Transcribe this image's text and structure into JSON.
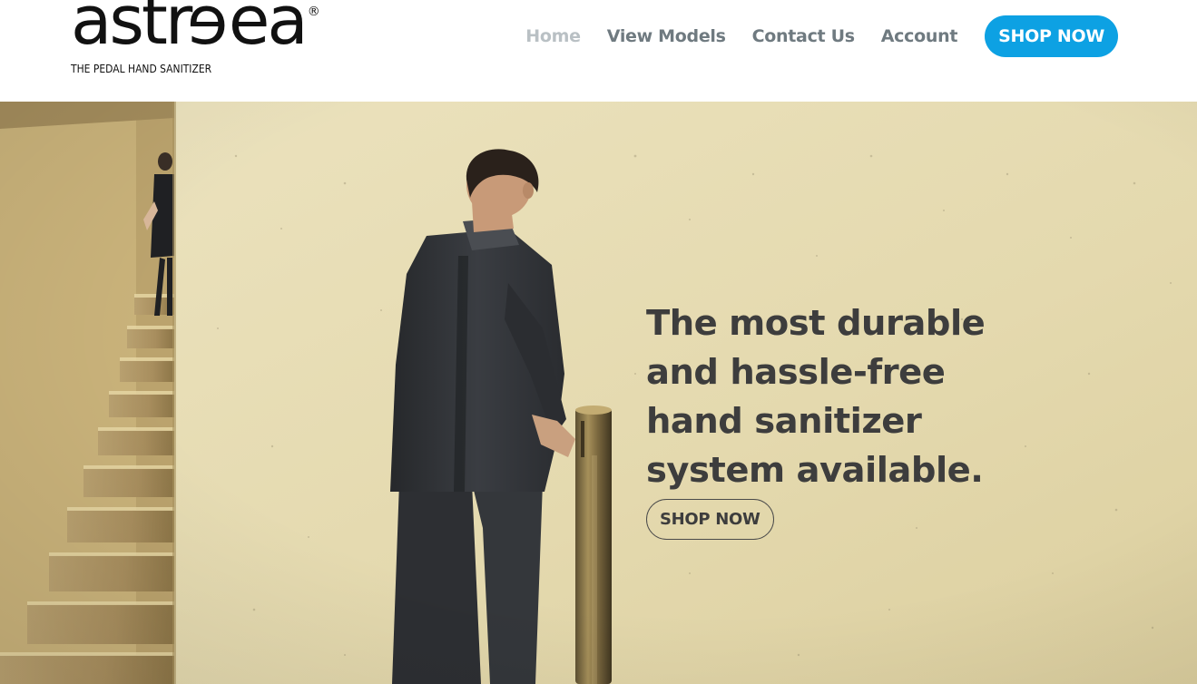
{
  "brand": {
    "logo_prefix": "astr",
    "logo_flipped": "e",
    "logo_suffix": "ea",
    "logo_mark": "®",
    "tagline": "THE PEDAL HAND SANITIZER"
  },
  "nav": {
    "items": [
      {
        "label": "Home",
        "active": true
      },
      {
        "label": "View Models",
        "active": false
      },
      {
        "label": "Contact Us",
        "active": false
      },
      {
        "label": "Account",
        "active": false
      }
    ],
    "cta_label": "SHOP NOW"
  },
  "hero": {
    "heading_lines": [
      "The most durable",
      "and hassle-free",
      "hand sanitizer",
      "system available."
    ],
    "cta_label": "SHOP NOW"
  },
  "colors": {
    "accent": "#0da1e3",
    "nav_text": "#6f7a80",
    "nav_active": "#b9c0c4",
    "heading": "#3d3d3d",
    "wall": "#e6dcb3"
  }
}
